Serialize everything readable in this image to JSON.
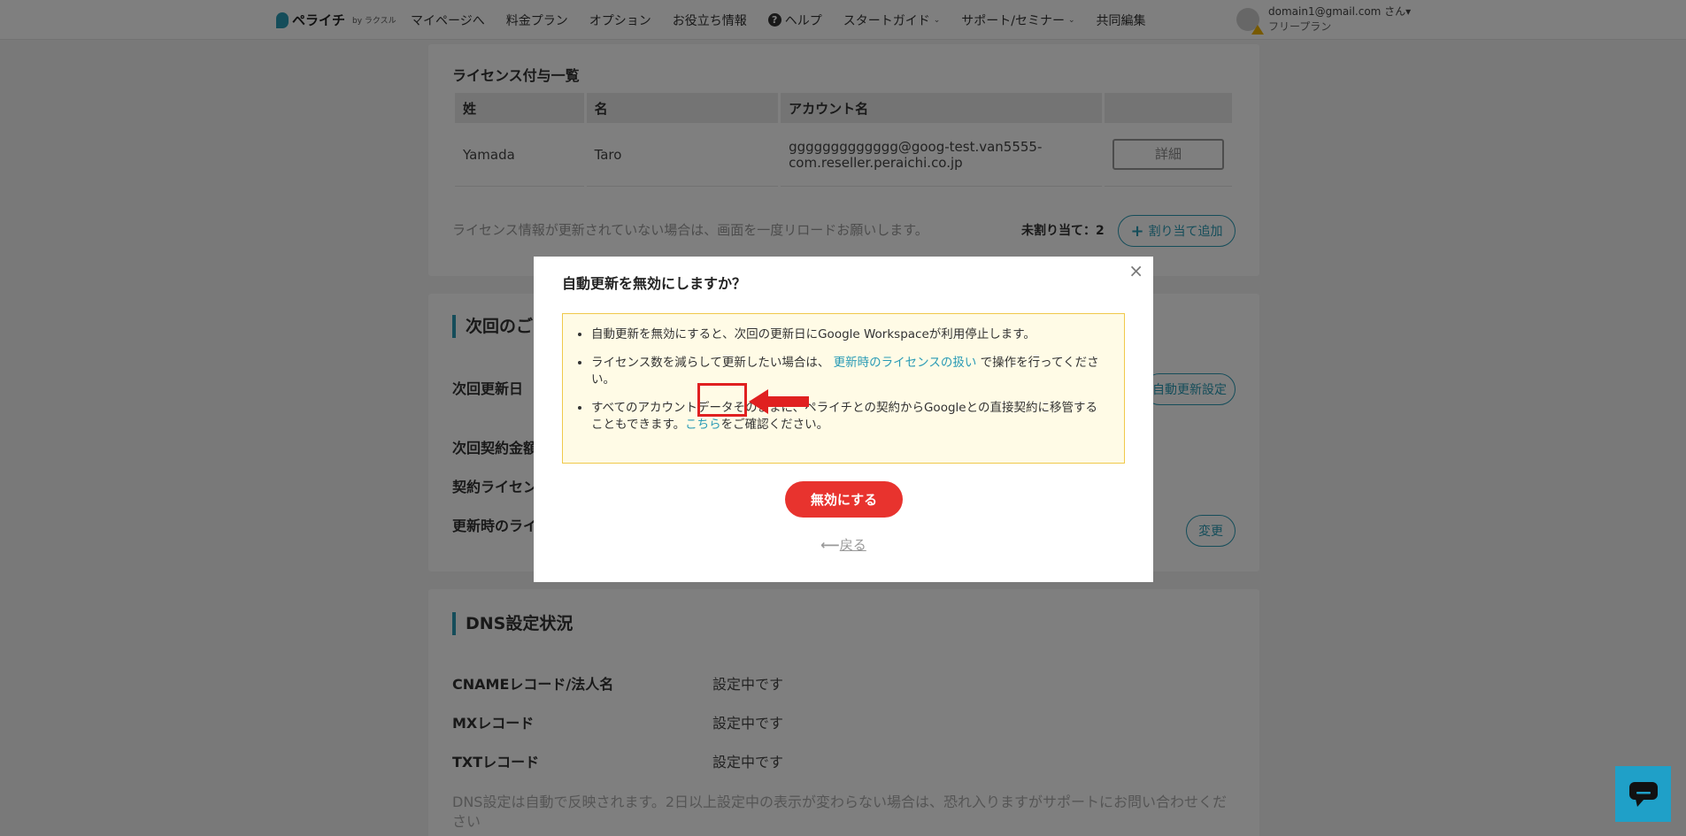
{
  "header": {
    "logo_text": "ペライチ",
    "logo_by": "by ラクスル",
    "nav": [
      {
        "label": "マイページへ"
      },
      {
        "label": "料金プラン"
      },
      {
        "label": "オプション"
      },
      {
        "label": "お役立ち情報"
      },
      {
        "label": "ヘルプ"
      },
      {
        "label": "スタートガイド"
      },
      {
        "label": "サポート/セミナー"
      },
      {
        "label": "共同編集"
      }
    ],
    "help_icon": "?",
    "user_email": "domain1@gmail.com さん",
    "user_plan": "フリープラン"
  },
  "license_section": {
    "title": "ライセンス付与一覧",
    "columns": [
      "姓",
      "名",
      "アカウント名",
      ""
    ],
    "rows": [
      {
        "last": "Yamada",
        "first": "Taro",
        "account_line1": "ggggggggggggg@goog-test.van5555-",
        "account_line2": "com.reseller.peraichi.co.jp",
        "detail_label": "詳細"
      }
    ],
    "reload_note": "ライセンス情報が更新されていない場合は、画面を一度リロードお願いします。",
    "unassigned": "未割り当て：2",
    "assign_button": "割り当て追加"
  },
  "renewal_section": {
    "heading": "次回のご",
    "rows": [
      "次回更新日",
      "次回契約金額",
      "契約ライセン",
      "更新時のライ"
    ],
    "auto_renew_button": "自動更新設定",
    "change_button": "変更"
  },
  "dns_section": {
    "heading": "DNS設定状況",
    "rows": [
      {
        "label": "CNAMEレコード/法人名",
        "value": "設定中です"
      },
      {
        "label": "MXレコード",
        "value": "設定中です"
      },
      {
        "label": "TXTレコード",
        "value": "設定中です"
      }
    ],
    "note": "DNS設定は自動で反映されます。2日以上設定中の表示が変わらない場合は、恐れ入りますがサポートにお問い合わせください"
  },
  "modal": {
    "title": "自動更新を無効にしますか？",
    "close": "×",
    "bullet1": "自動更新を無効にすると、次回の更新日にGoogle Workspaceが利用停止します。",
    "bullet2_pre": "ライセンス数を減らして更新したい場合は、",
    "bullet2_link": "更新時のライセンスの扱い",
    "bullet2_post": "で操作を行ってください。",
    "bullet3_pre": "すべてのアカウントデータそのままに、ペライチとの契約からGoogleとの直接契約に移管することもできます。",
    "bullet3_link": "こちら",
    "bullet3_post": "をご確認ください。",
    "disable_button": "無効にする",
    "back_label": "戻る"
  },
  "colors": {
    "accent": "#2a9bb5",
    "danger": "#e8332e",
    "notice_bg": "#fffbe6",
    "notice_border": "#f0c94b",
    "chat": "#1fa0c8"
  }
}
